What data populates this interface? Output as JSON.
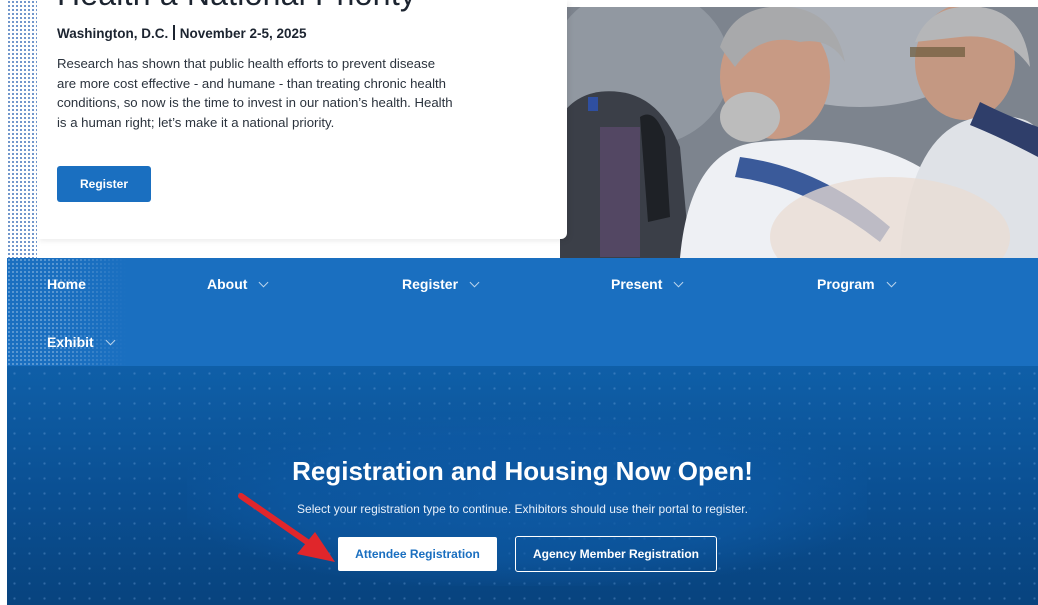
{
  "hero": {
    "title": "Health a National Priority",
    "location": "Washington, D.C.",
    "dates": "November 2-5, 2025",
    "description": "Research has shown that public health efforts to prevent disease are more cost effective - and humane - than treating chronic health conditions, so now is the time to invest in our nation’s health. Health is a human right; let’s make it a national priority.",
    "register_label": "Register"
  },
  "nav": {
    "items": [
      {
        "label": "Home",
        "has_dropdown": false
      },
      {
        "label": "About",
        "has_dropdown": true
      },
      {
        "label": "Register",
        "has_dropdown": true
      },
      {
        "label": "Present",
        "has_dropdown": true
      },
      {
        "label": "Program",
        "has_dropdown": true
      },
      {
        "label": "Exhibit",
        "has_dropdown": true
      }
    ]
  },
  "registration": {
    "title": "Registration and Housing Now Open!",
    "subtitle": "Select your registration type to continue. Exhibitors should use their portal to register.",
    "attendee_label": "Attendee Registration",
    "agency_label": "Agency Member Registration"
  },
  "colors": {
    "primary": "#1a6fc0",
    "banner": "#0a4f92",
    "arrow": "#e0262b",
    "text_dark": "#1c2430"
  },
  "icons": [
    "chevron-down-icon",
    "red-arrow-annotation"
  ]
}
